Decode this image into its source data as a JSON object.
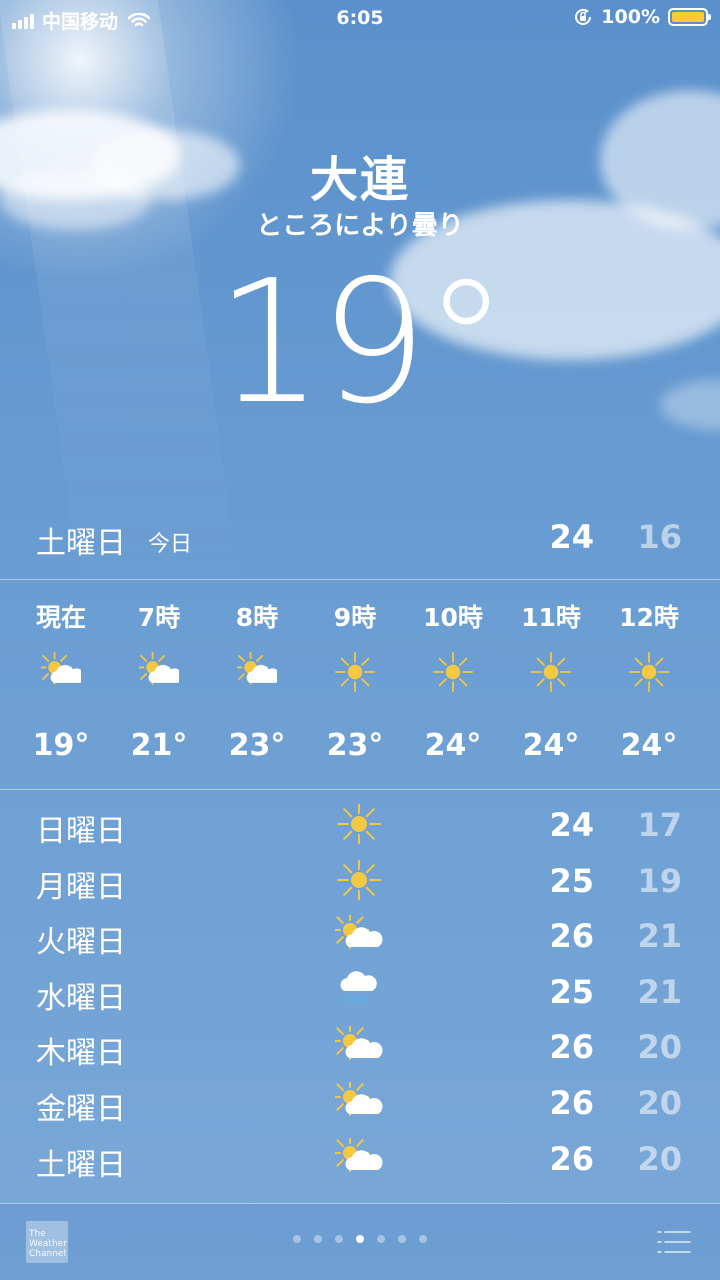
{
  "status_bar": {
    "carrier": "中国移动",
    "time": "6:05",
    "battery": "100%",
    "battery_color": "#ffcc2e"
  },
  "header": {
    "city": "大連",
    "condition": "ところにより曇り",
    "temperature": "19°"
  },
  "today": {
    "day": "土曜日",
    "label": "今日",
    "high": "24",
    "low": "16"
  },
  "hourly": [
    {
      "label": "現在",
      "icon": "partly-cloudy-icon",
      "temp": "19°"
    },
    {
      "label": "7時",
      "icon": "partly-cloudy-icon",
      "temp": "21°"
    },
    {
      "label": "8時",
      "icon": "partly-cloudy-icon",
      "temp": "23°"
    },
    {
      "label": "9時",
      "icon": "sun-icon",
      "temp": "23°"
    },
    {
      "label": "10時",
      "icon": "sun-icon",
      "temp": "24°"
    },
    {
      "label": "11時",
      "icon": "sun-icon",
      "temp": "24°"
    },
    {
      "label": "12時",
      "icon": "sun-icon",
      "temp": "24°"
    }
  ],
  "daily": [
    {
      "day": "日曜日",
      "icon": "sun-icon",
      "high": "24",
      "low": "17"
    },
    {
      "day": "月曜日",
      "icon": "sun-icon",
      "high": "25",
      "low": "19"
    },
    {
      "day": "火曜日",
      "icon": "partly-cloudy-icon",
      "high": "26",
      "low": "21"
    },
    {
      "day": "水曜日",
      "icon": "rain-icon",
      "high": "25",
      "low": "21"
    },
    {
      "day": "木曜日",
      "icon": "partly-cloudy-icon",
      "high": "26",
      "low": "20"
    },
    {
      "day": "金曜日",
      "icon": "partly-cloudy-icon",
      "high": "26",
      "low": "20"
    },
    {
      "day": "土曜日",
      "icon": "partly-cloudy-icon",
      "high": "26",
      "low": "20"
    }
  ],
  "bottom_bar": {
    "logo_text": "The Weather Channel",
    "page_count": 7,
    "active_page": 4
  },
  "colors": {
    "sun": "#f5c842",
    "rain": "#4fb6ee"
  }
}
